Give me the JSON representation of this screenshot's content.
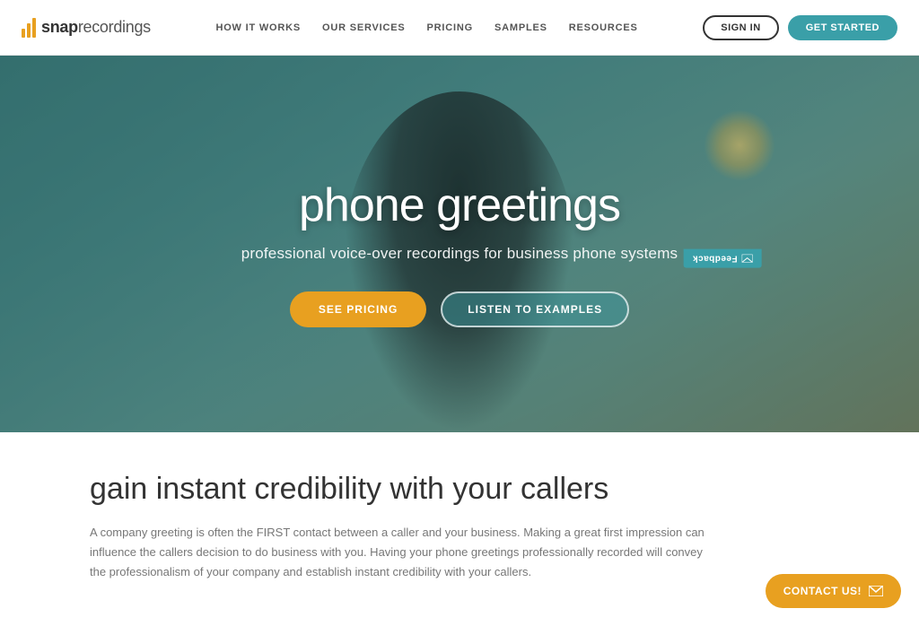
{
  "brand": {
    "name_bold": "snap",
    "name_light": "recordings"
  },
  "nav": {
    "links": [
      {
        "label": "HOW IT WORKS",
        "id": "how-it-works"
      },
      {
        "label": "OUR SERVICES",
        "id": "our-services"
      },
      {
        "label": "PRICING",
        "id": "pricing"
      },
      {
        "label": "SAMPLES",
        "id": "samples"
      },
      {
        "label": "RESOURCES",
        "id": "resources"
      }
    ],
    "signin_label": "SIGN IN",
    "getstarted_label": "GET STARTED"
  },
  "hero": {
    "title": "phone greetings",
    "subtitle": "professional voice-over recordings for business phone systems",
    "btn_pricing": "SEE PRICING",
    "btn_examples": "LISTEN TO EXAMPLES"
  },
  "feedback": {
    "label": "Feedback"
  },
  "content": {
    "title": "gain instant credibility with your callers",
    "paragraph": "A company greeting is often the FIRST contact between a caller and your business. Making a great first impression can influence the callers decision to do business with you. Having your phone greetings professionally recorded will convey the professionalism of your company and establish instant credibility with your callers."
  },
  "contact": {
    "label": "CONTACT US!"
  },
  "colors": {
    "accent_orange": "#e8a020",
    "accent_teal": "#3a9fa8",
    "nav_text": "#555",
    "body_text": "#333",
    "subtitle_text": "#777"
  }
}
